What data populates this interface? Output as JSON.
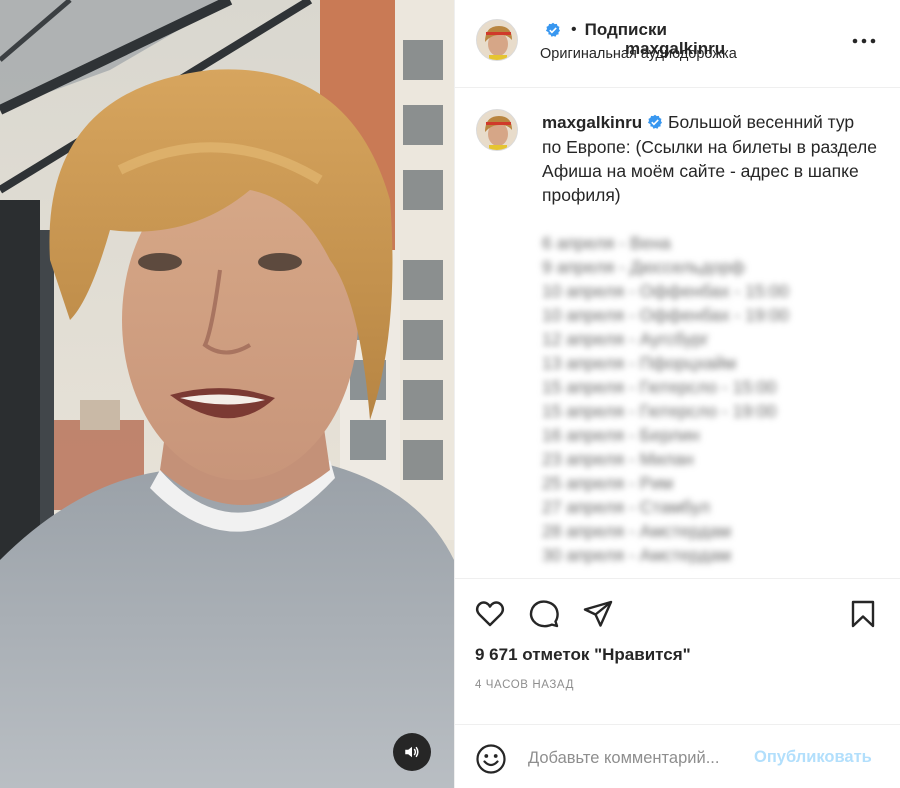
{
  "post": {
    "username": "maxgalkinru",
    "follow_label": "Подписки",
    "separator": "•",
    "audio_label": "Оригинальная аудиодорожка",
    "caption_text": "Большой весенний тур по Европе: (Ссылки на билеты в разделе Афиша на моём сайте - адрес в шапке профиля)",
    "tour_dates": [
      "6 апреля - Вена",
      "9 апреля - Дюссельдорф",
      "10 апреля - Оффенбах - 15:00",
      "10 апреля - Оффенбах - 19:00",
      "12 апреля - Аугсбург",
      "13 апреля - Пфорцхайм",
      "15 апреля - Гютерсло - 15:00",
      "15 апреля - Гютерсло - 19:00",
      "16 апреля - Берлин",
      "23 апреля - Милан",
      "25 апреля - Рим",
      "27 апреля - Стамбул",
      "28 апреля - Амстердам",
      "30 апреля - Амстердам"
    ],
    "likes_text": "9 671 отметок \"Нравится\"",
    "time_text": "4 ЧАСОВ НАЗАД",
    "comment_placeholder": "Добавьте комментарий...",
    "publish_label": "Опубликовать"
  },
  "icons": {
    "verified": "verified-badge-icon",
    "more": "more-options-icon",
    "like": "heart-icon",
    "comment": "comment-bubble-icon",
    "share": "paper-plane-icon",
    "save": "bookmark-icon",
    "emoji": "smiley-icon",
    "sound": "speaker-icon"
  },
  "colors": {
    "verified_blue": "#3897f0",
    "publish_disabled": "#b2dffc",
    "muted_text": "#8e8e8e",
    "primary_text": "#262626"
  }
}
